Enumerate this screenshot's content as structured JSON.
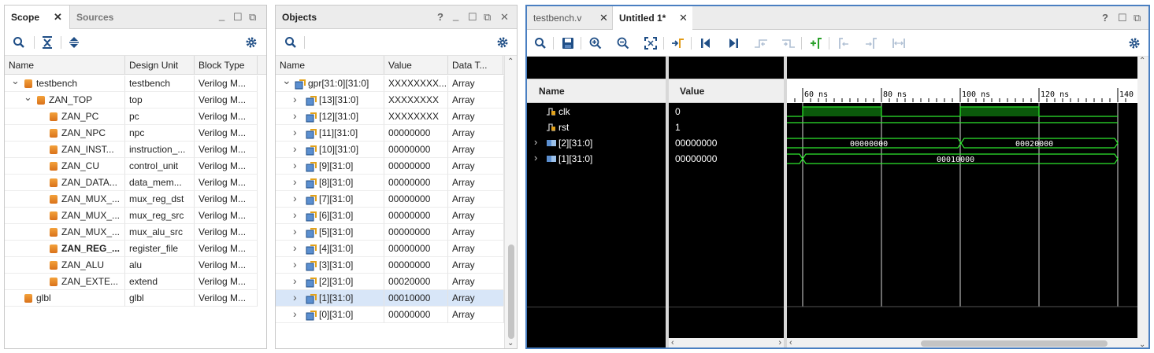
{
  "scope_panel": {
    "tabs": [
      {
        "label": "Scope"
      },
      {
        "label": "Sources"
      }
    ],
    "columns": [
      "Name",
      "Design Unit",
      "Block Type"
    ],
    "rows": [
      {
        "name": "testbench",
        "unit": "testbench",
        "type": "Verilog M...",
        "level": 0,
        "chevron": "v",
        "bold": false
      },
      {
        "name": "ZAN_TOP",
        "unit": "top",
        "type": "Verilog M...",
        "level": 1,
        "chevron": "v",
        "bold": false
      },
      {
        "name": "ZAN_PC",
        "unit": "pc",
        "type": "Verilog M...",
        "level": 2,
        "chevron": "",
        "bold": false
      },
      {
        "name": "ZAN_NPC",
        "unit": "npc",
        "type": "Verilog M...",
        "level": 2,
        "chevron": "",
        "bold": false
      },
      {
        "name": "ZAN_INST...",
        "unit": "instruction_...",
        "type": "Verilog M...",
        "level": 2,
        "chevron": "",
        "bold": false
      },
      {
        "name": "ZAN_CU",
        "unit": "control_unit",
        "type": "Verilog M...",
        "level": 2,
        "chevron": "",
        "bold": false
      },
      {
        "name": "ZAN_DATA...",
        "unit": "data_mem...",
        "type": "Verilog M...",
        "level": 2,
        "chevron": "",
        "bold": false
      },
      {
        "name": "ZAN_MUX_...",
        "unit": "mux_reg_dst",
        "type": "Verilog M...",
        "level": 2,
        "chevron": "",
        "bold": false
      },
      {
        "name": "ZAN_MUX_...",
        "unit": "mux_reg_src",
        "type": "Verilog M...",
        "level": 2,
        "chevron": "",
        "bold": false
      },
      {
        "name": "ZAN_MUX_...",
        "unit": "mux_alu_src",
        "type": "Verilog M...",
        "level": 2,
        "chevron": "",
        "bold": false
      },
      {
        "name": "ZAN_REG_...",
        "unit": "register_file",
        "type": "Verilog M...",
        "level": 2,
        "chevron": "",
        "bold": true
      },
      {
        "name": "ZAN_ALU",
        "unit": "alu",
        "type": "Verilog M...",
        "level": 2,
        "chevron": "",
        "bold": false
      },
      {
        "name": "ZAN_EXTE...",
        "unit": "extend",
        "type": "Verilog M...",
        "level": 2,
        "chevron": "",
        "bold": false
      },
      {
        "name": "glbl",
        "unit": "glbl",
        "type": "Verilog M...",
        "level": 0,
        "chevron": "",
        "bold": false
      }
    ]
  },
  "objects_panel": {
    "title": "Objects",
    "columns": [
      "Name",
      "Value",
      "Data T..."
    ],
    "rows": [
      {
        "name": "gpr[31:0][31:0]",
        "value": "XXXXXXXX...",
        "type": "Array",
        "chevron": "v",
        "selected": false
      },
      {
        "name": "[13][31:0]",
        "value": "XXXXXXXX",
        "type": "Array",
        "chevron": ">",
        "selected": false
      },
      {
        "name": "[12][31:0]",
        "value": "XXXXXXXX",
        "type": "Array",
        "chevron": ">",
        "selected": false
      },
      {
        "name": "[11][31:0]",
        "value": "00000000",
        "type": "Array",
        "chevron": ">",
        "selected": false
      },
      {
        "name": "[10][31:0]",
        "value": "00000000",
        "type": "Array",
        "chevron": ">",
        "selected": false
      },
      {
        "name": "[9][31:0]",
        "value": "00000000",
        "type": "Array",
        "chevron": ">",
        "selected": false
      },
      {
        "name": "[8][31:0]",
        "value": "00000000",
        "type": "Array",
        "chevron": ">",
        "selected": false
      },
      {
        "name": "[7][31:0]",
        "value": "00000000",
        "type": "Array",
        "chevron": ">",
        "selected": false
      },
      {
        "name": "[6][31:0]",
        "value": "00000000",
        "type": "Array",
        "chevron": ">",
        "selected": false
      },
      {
        "name": "[5][31:0]",
        "value": "00000000",
        "type": "Array",
        "chevron": ">",
        "selected": false
      },
      {
        "name": "[4][31:0]",
        "value": "00000000",
        "type": "Array",
        "chevron": ">",
        "selected": false
      },
      {
        "name": "[3][31:0]",
        "value": "00000000",
        "type": "Array",
        "chevron": ">",
        "selected": false
      },
      {
        "name": "[2][31:0]",
        "value": "00020000",
        "type": "Array",
        "chevron": ">",
        "selected": false
      },
      {
        "name": "[1][31:0]",
        "value": "00010000",
        "type": "Array",
        "chevron": ">",
        "selected": true
      },
      {
        "name": "[0][31:0]",
        "value": "00000000",
        "type": "Array",
        "chevron": ">",
        "selected": false
      }
    ]
  },
  "wave_panel": {
    "tabs": [
      {
        "label": "testbench.v"
      },
      {
        "label": "Untitled 1*"
      }
    ],
    "name_header": "Name",
    "value_header": "Value",
    "signals": [
      {
        "name": "clk",
        "value": "0",
        "kind": "bit",
        "chevron": ""
      },
      {
        "name": "rst",
        "value": "1",
        "kind": "bit",
        "chevron": ""
      },
      {
        "name": "[2][31:0]",
        "value": "00000000",
        "kind": "bus",
        "chevron": ">"
      },
      {
        "name": "[1][31:0]",
        "value": "00000000",
        "kind": "bus",
        "chevron": ">"
      }
    ],
    "time_ticks": [
      "60 ns",
      "80 ns",
      "100 ns",
      "120 ns",
      "140"
    ],
    "bus2_segments": [
      "00000000",
      "00020000"
    ],
    "bus1_segments": [
      "00010000"
    ]
  },
  "colors": {
    "wave_green": "#2ee82e",
    "selected_row": "#d8e6f8",
    "window_border": "#4a7fc1"
  }
}
